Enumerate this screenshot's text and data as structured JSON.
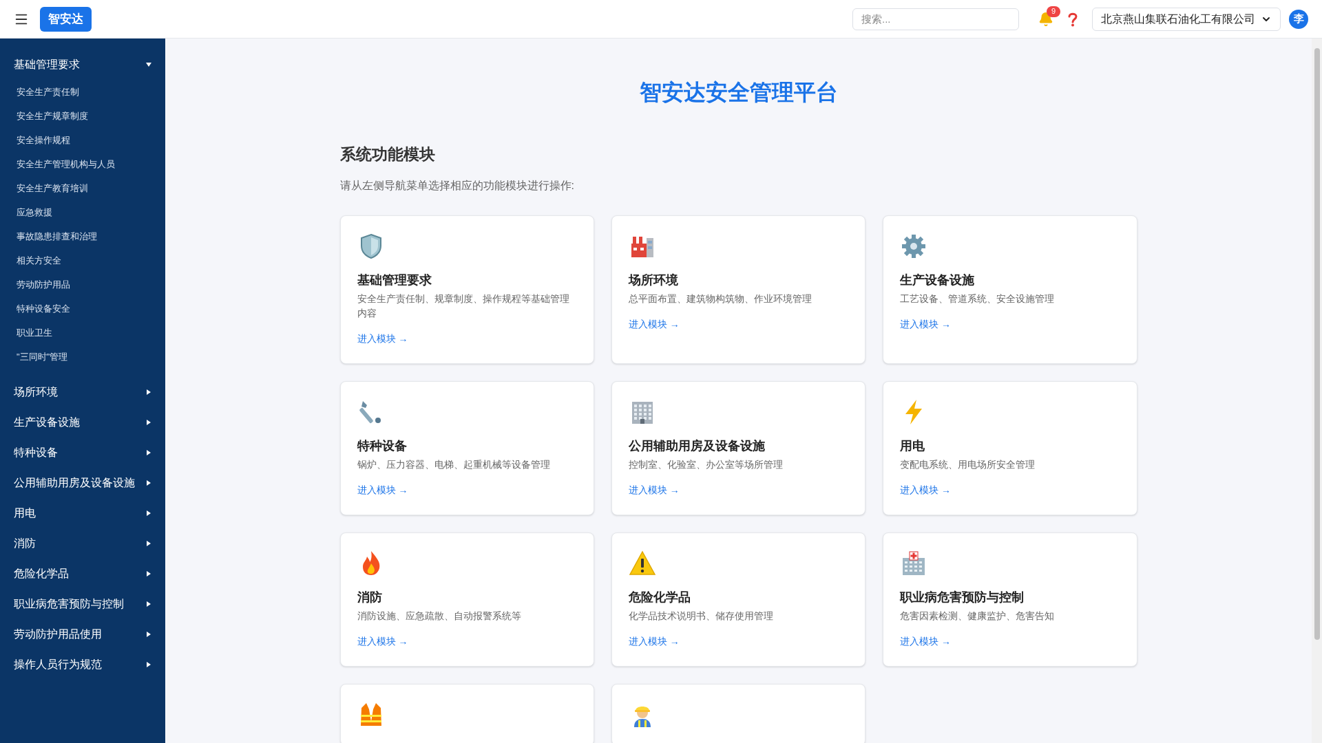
{
  "header": {
    "logo": "智安达",
    "search": {
      "placeholder": "搜索..."
    },
    "notifications": {
      "count": "9"
    },
    "company": {
      "value": "北京燕山集联石油化工有限公司"
    },
    "avatar": "李"
  },
  "sidebar": {
    "items": [
      {
        "label": "基础管理要求",
        "expanded": true,
        "children": [
          {
            "label": "安全生产责任制"
          },
          {
            "label": "安全生产规章制度"
          },
          {
            "label": "安全操作规程"
          },
          {
            "label": "安全生产管理机构与人员"
          },
          {
            "label": "安全生产教育培训"
          },
          {
            "label": "应急救援"
          },
          {
            "label": "事故隐患排查和治理"
          },
          {
            "label": "相关方安全"
          },
          {
            "label": "劳动防护用品"
          },
          {
            "label": "特种设备安全"
          },
          {
            "label": "职业卫生"
          },
          {
            "label": "\"三同时\"管理"
          }
        ]
      },
      {
        "label": "场所环境",
        "expanded": false
      },
      {
        "label": "生产设备设施",
        "expanded": false
      },
      {
        "label": "特种设备",
        "expanded": false
      },
      {
        "label": "公用辅助用房及设备设施",
        "expanded": false
      },
      {
        "label": "用电",
        "expanded": false
      },
      {
        "label": "消防",
        "expanded": false
      },
      {
        "label": "危险化学品",
        "expanded": false
      },
      {
        "label": "职业病危害预防与控制",
        "expanded": false
      },
      {
        "label": "劳动防护用品使用",
        "expanded": false
      },
      {
        "label": "操作人员行为规范",
        "expanded": false
      }
    ]
  },
  "main": {
    "title": "智安达安全管理平台",
    "section": {
      "heading": "系统功能模块",
      "hint": "请从左侧导航菜单选择相应的功能模块进行操作:"
    },
    "cards": [
      {
        "kind": "shield",
        "title": "基础管理要求",
        "description": "安全生产责任制、规章制度、操作规程等基础管理内容",
        "link": "进入模块 →"
      },
      {
        "kind": "factory",
        "title": "场所环境",
        "description": "总平面布置、建筑物构筑物、作业环境管理",
        "link": "进入模块 →"
      },
      {
        "kind": "gear",
        "title": "生产设备设施",
        "description": "工艺设备、管道系统、安全设施管理",
        "link": "进入模块 →"
      },
      {
        "kind": "wrench",
        "title": "特种设备",
        "description": "锅炉、压力容器、电梯、起重机械等设备管理",
        "link": "进入模块 →"
      },
      {
        "kind": "building",
        "title": "公用辅助用房及设备设施",
        "description": "控制室、化验室、办公室等场所管理",
        "link": "进入模块 →"
      },
      {
        "kind": "lightning",
        "title": "用电",
        "description": "变配电系统、用电场所安全管理",
        "link": "进入模块 →"
      },
      {
        "kind": "fire",
        "title": "消防",
        "description": "消防设施、应急疏散、自动报警系统等",
        "link": "进入模块 →"
      },
      {
        "kind": "warning",
        "title": "危险化学品",
        "description": "化学品技术说明书、储存使用管理",
        "link": "进入模块 →"
      },
      {
        "kind": "hospital",
        "title": "职业病危害预防与控制",
        "description": "危害因素检测、健康监护、危害告知",
        "link": "进入模块 →"
      },
      {
        "kind": "vest"
      },
      {
        "kind": "worker"
      }
    ]
  }
}
